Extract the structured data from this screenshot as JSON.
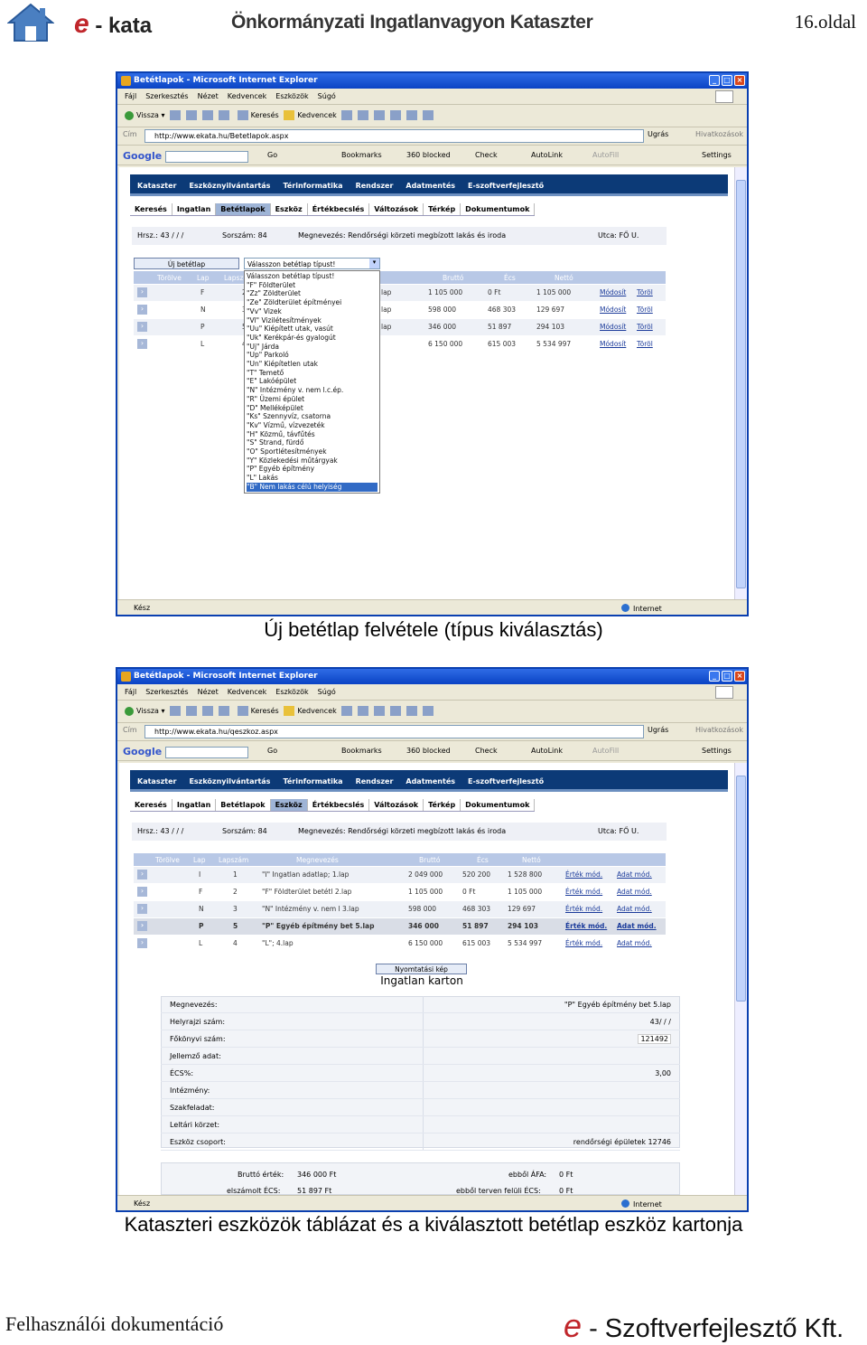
{
  "header": {
    "logo_e": "e",
    "logo_rest": "- kata",
    "title": "Önkormányzati Ingatlanvagyon Kataszter",
    "page": "16.oldal"
  },
  "browser": {
    "title": "Betétlapok - Microsoft Internet Explorer",
    "menu": [
      "Fájl",
      "Szerkesztés",
      "Nézet",
      "Kedvencek",
      "Eszközök",
      "Súgó"
    ],
    "toolbar": {
      "back": "Vissza",
      "search": "Keresés",
      "favorites": "Kedvencek"
    },
    "address_label": "Cím",
    "go": "Ugrás",
    "links": "Hivatkozások",
    "google": {
      "logo": "Google",
      "go": "Go",
      "bookmarks": "Bookmarks",
      "blocked": "360 blocked",
      "check": "Check",
      "autolink": "AutoLink",
      "autofill": "AutoFill",
      "settings": "Settings"
    },
    "status": "Kész",
    "zone": "Internet"
  },
  "app": {
    "nav1": [
      "Kataszter",
      "Eszköznyilvántartás",
      "Térinformatika",
      "Rendszer",
      "Adatmentés",
      "E-szoftverfejlesztő"
    ],
    "nav2": [
      "Keresés",
      "Ingatlan",
      "Betétlapok",
      "Eszköz",
      "Értékbecslés",
      "Változások",
      "Térkép",
      "Dokumentumok"
    ],
    "info": {
      "hrsz": "Hrsz.:  43 / / /",
      "sorszam": "Sorszám:  84",
      "megnevezes": "Megnevezés:  Rendőrségi körzeti megbízott lakás és iroda",
      "utca": "Utca:  FŐ U."
    }
  },
  "shot1": {
    "url": "http://www.ekata.hu/Betetlapok.aspx",
    "new_button": "Új betétlap",
    "select_value": "Válasszon betétlap típust!",
    "headers": [
      "Törölve",
      "Lap",
      "Lapsz",
      "Bruttó",
      "Écs",
      "Nettó"
    ],
    "rows": [
      {
        "type": "F",
        "num": "2",
        "lap": "lap",
        "brutto": "1 105 000",
        "ecs": "0 Ft",
        "netto": "1 105 000",
        "a1": "Módosít",
        "a2": "Töröl"
      },
      {
        "type": "N",
        "num": "3",
        "lap": "lap",
        "brutto": "598 000",
        "ecs": "468 303",
        "netto": "129 697",
        "a1": "Módosít",
        "a2": "Töröl"
      },
      {
        "type": "P",
        "num": "5",
        "lap": "lap",
        "brutto": "346 000",
        "ecs": "51 897",
        "netto": "294 103",
        "a1": "Módosít",
        "a2": "Töröl"
      },
      {
        "type": "L",
        "num": "4",
        "lap": "",
        "brutto": "6 150 000",
        "ecs": "615 003",
        "netto": "5 534 997",
        "a1": "Módosít",
        "a2": "Töröl"
      }
    ],
    "options": [
      "Válasszon betétlap típust!",
      "\"F\" Földterület",
      "\"Zz\" Zöldterület",
      "\"Ze\" Zöldterület építményei",
      "\"Vv\" Vizek",
      "\"Vl\" Vizilétesítmények",
      "\"Uu\" Kiépített utak, vasút",
      "\"Uk\" Kerékpár-és gyalogút",
      "\"Uj\" Járda",
      "\"Up\" Parkoló",
      "\"Un\" Kiépítetlen utak",
      "\"T\" Temető",
      "\"E\" Lakóépület",
      "\"N\" Intézmény v. nem l.c.ép.",
      "\"R\" Üzemi épület",
      "\"D\" Melléképület",
      "\"Ks\" Szennyvíz, csatorna",
      "\"Kv\" Vízmű, vízvezeték",
      "\"H\" Közmű, távfűtés",
      "\"S\" Strand, fürdő",
      "\"O\" Sportlétesítmények",
      "\"Y\" Közlekedési műtárgyak",
      "\"P\" Egyéb építmény",
      "\"L\" Lakás",
      "\"B\" Nem lakás célú helyiség"
    ],
    "caption": "Új betétlap felvétele (típus kiválasztás)"
  },
  "shot2": {
    "url": "http://www.ekata.hu/qeszkoz.aspx",
    "headers": [
      "Törölve",
      "Lap",
      "Lapszám",
      "Megnevezés",
      "Bruttó",
      "Écs",
      "Nettó"
    ],
    "rows": [
      {
        "type": "I",
        "num": "1",
        "name": "\"I\" Ingatlan adatlap; 1.lap",
        "brutto": "2 049 000",
        "ecs": "520 200",
        "netto": "1 528 800",
        "a1": "Érték mód.",
        "a2": "Adat mód."
      },
      {
        "type": "F",
        "num": "2",
        "name": "\"F\" Földterület betétl 2.lap",
        "brutto": "1 105 000",
        "ecs": "0 Ft",
        "netto": "1 105 000",
        "a1": "Érték mód.",
        "a2": "Adat mód."
      },
      {
        "type": "N",
        "num": "3",
        "name": "\"N\" Intézmény v. nem l 3.lap",
        "brutto": "598 000",
        "ecs": "468 303",
        "netto": "129 697",
        "a1": "Érték mód.",
        "a2": "Adat mód."
      },
      {
        "type": "P",
        "num": "5",
        "name": "\"P\" Egyéb építmény bet 5.lap",
        "brutto": "346 000",
        "ecs": "51 897",
        "netto": "294 103",
        "a1": "Érték mód.",
        "a2": "Adat mód."
      },
      {
        "type": "L",
        "num": "4",
        "name": "\"L\"; 4.lap",
        "brutto": "6 150 000",
        "ecs": "615 003",
        "netto": "5 534 997",
        "a1": "Érték mód.",
        "a2": "Adat mód."
      }
    ],
    "print_button": "Nyomtatási kép",
    "card_title": "Ingatlan karton",
    "card": [
      {
        "k": "Megnevezés:",
        "v": "\"P\" Egyéb építmény bet 5.lap"
      },
      {
        "k": "Helyrajzi szám:",
        "v": "43/ / /"
      },
      {
        "k": "Főkönyvi szám:",
        "v": "121492"
      },
      {
        "k": "Jellemző adat:",
        "v": ""
      },
      {
        "k": "ÉCS%:",
        "v": "3,00"
      },
      {
        "k": "Intézmény:",
        "v": ""
      },
      {
        "k": "Szakfeladat:",
        "v": ""
      },
      {
        "k": "Leltári körzet:",
        "v": ""
      },
      {
        "k": "Eszköz csoport:",
        "v": "rendőrségi épületek  12746"
      }
    ],
    "sum": {
      "l1": "Bruttó érték:",
      "v1": "346 000 Ft",
      "l2": "ebből ÁFA:",
      "v2": "0 Ft",
      "l3": "elszámolt ÉCS:",
      "v3": "51 897 Ft",
      "l4": "ebből terven felüli ÉCS:",
      "v4": "0 Ft"
    },
    "caption": "Kataszteri eszközök táblázat és a kiválasztott betétlap eszköz kartonja"
  },
  "footer": {
    "left": "Felhasználói dokumentáció",
    "logo_e": "e",
    "right": "- Szoftverfejlesztő Kft."
  }
}
